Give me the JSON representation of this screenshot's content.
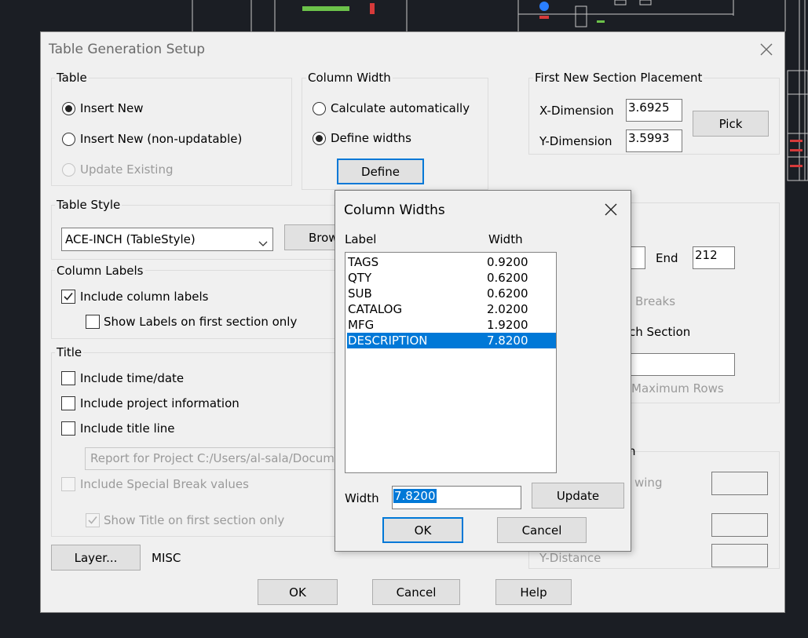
{
  "cad_background": {
    "colors": {
      "bg": "#1b1e24",
      "line": "#c8c8c8",
      "accent_green": "#6cc24a",
      "accent_red": "#d63a3a",
      "accent_blue": "#2a7fff"
    }
  },
  "main_dialog": {
    "title": "Table Generation Setup",
    "table_group": {
      "label": "Table",
      "options": [
        {
          "label": "Insert New",
          "selected": true,
          "enabled": true
        },
        {
          "label": "Insert New (non-updatable)",
          "selected": false,
          "enabled": true
        },
        {
          "label": "Update Existing",
          "selected": false,
          "enabled": false
        }
      ]
    },
    "column_width_group": {
      "label": "Column Width",
      "options": [
        {
          "label": "Calculate automatically",
          "selected": false
        },
        {
          "label": "Define widths",
          "selected": true
        }
      ],
      "define_button": "Define"
    },
    "placement_group": {
      "label": "First New Section Placement",
      "x_label": "X-Dimension",
      "x_value": "3.6925",
      "y_label": "Y-Dimension",
      "y_value": "3.5993",
      "pick_button": "Pick"
    },
    "table_style": {
      "label": "Table Style",
      "selected": "ACE-INCH  (TableStyle)",
      "browse_button": "Browse..."
    },
    "column_labels": {
      "label": "Column Labels",
      "include_label": "Include column labels",
      "include_checked": true,
      "show_first_label": "Show Labels on first section only",
      "show_first_checked": false
    },
    "title_group": {
      "label": "Title",
      "include_time": "Include time/date",
      "include_project": "Include project information",
      "include_title_line": "Include title line",
      "title_text": "Report for Project C:/Users/al-sala/Documen",
      "special_break": "Include Special Break values",
      "show_title_first": "Show Title on first section only"
    },
    "partial_right": {
      "end_label": "End",
      "end_value": "212",
      "breaks_text": "Breaks",
      "each_section_text": "ch Section",
      "max_rows_text": "Maximum Rows",
      "drawing_text": "wing",
      "group_tail_text": "n",
      "y_distance_text": "Y-Distance"
    },
    "layer_button": "Layer...",
    "layer_value": "MISC",
    "ok_button": "OK",
    "cancel_button": "Cancel",
    "help_button": "Help"
  },
  "column_widths_dialog": {
    "title": "Column Widths",
    "header_label": "Label",
    "header_width": "Width",
    "rows": [
      {
        "label": "TAGS",
        "width": "0.9200"
      },
      {
        "label": "QTY",
        "width": "0.6200"
      },
      {
        "label": "SUB",
        "width": "0.6200"
      },
      {
        "label": "CATALOG",
        "width": "2.0200"
      },
      {
        "label": "MFG",
        "width": "1.9200"
      },
      {
        "label": "DESCRIPTION",
        "width": "7.8200"
      }
    ],
    "selected_index": 5,
    "width_label": "Width",
    "width_value": "7.8200",
    "update_button": "Update",
    "ok_button": "OK",
    "cancel_button": "Cancel"
  }
}
